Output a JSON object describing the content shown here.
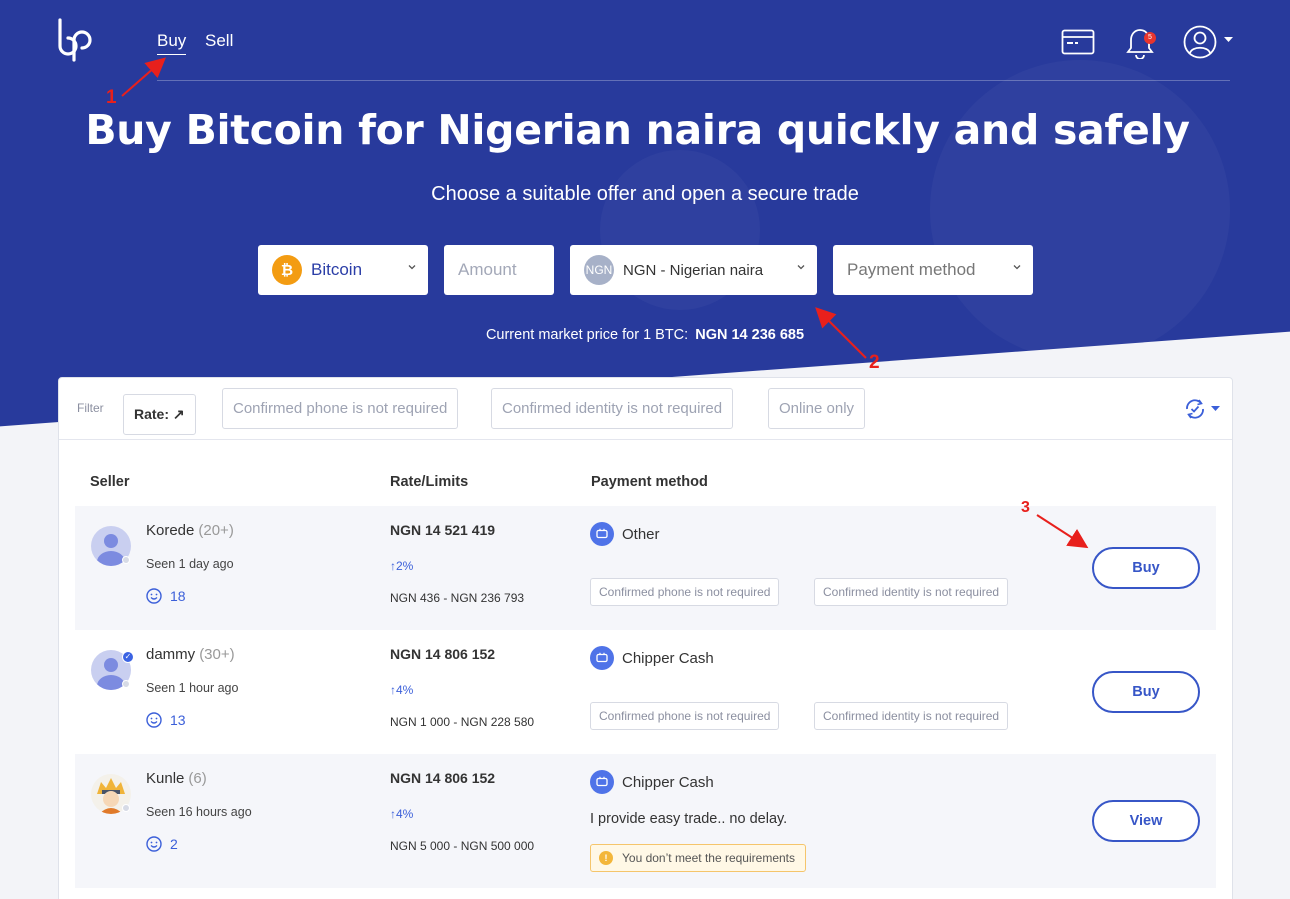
{
  "nav": {
    "buy": "Buy",
    "sell": "Sell",
    "notification_count": "5"
  },
  "hero": {
    "title": "Buy Bitcoin for Nigerian naira quickly and safely",
    "subtitle": "Choose a suitable offer and open a secure trade"
  },
  "search": {
    "crypto": "Bitcoin",
    "crypto_symbol": "₿",
    "amount_placeholder": "Amount",
    "currency": "NGN - Nigerian naira",
    "currency_code": "NGN",
    "payment_placeholder": "Payment method"
  },
  "market": {
    "label": "Current market price for 1 BTC:",
    "price": "NGN 14 236 685"
  },
  "filters": {
    "label": "Filter",
    "rate": "Rate: ↗",
    "phone": "Confirmed phone is not required",
    "identity": "Confirmed identity is not required",
    "online": "Online only"
  },
  "table": {
    "headers": {
      "seller": "Seller",
      "rate": "Rate/Limits",
      "payment": "Payment method"
    },
    "rows": [
      {
        "seller": "Korede",
        "count": "(20+)",
        "seen": "Seen 1 day ago",
        "reputation": "18",
        "rate": "NGN 14 521 419",
        "pct": "↑2%",
        "limits": "NGN 436 - NGN 236 793",
        "method": "Other",
        "tag1": "Confirmed phone is not required",
        "tag2": "Confirmed identity is not required",
        "action": "Buy"
      },
      {
        "seller": "dammy",
        "count": "(30+)",
        "seen": "Seen 1 hour ago",
        "reputation": "13",
        "rate": "NGN 14 806 152",
        "pct": "↑4%",
        "limits": "NGN 1 000 - NGN 228 580",
        "method": "Chipper Cash",
        "tag1": "Confirmed phone is not required",
        "tag2": "Confirmed identity is not required",
        "action": "Buy"
      },
      {
        "seller": "Kunle",
        "count": "(6)",
        "seen": "Seen 16 hours ago",
        "reputation": "2",
        "rate": "NGN 14 806 152",
        "pct": "↑4%",
        "limits": "NGN 5 000 - NGN 500 000",
        "method": "Chipper Cash",
        "description": "I provide easy trade.. no delay.",
        "warning": "You don’t meet the requirements",
        "action": "View"
      }
    ]
  },
  "annotations": {
    "a1": "1",
    "a2": "2",
    "a3": "3"
  },
  "colors": {
    "hero": "#283a9c",
    "accent": "#3756c7",
    "annotation": "#e8201c",
    "bitcoin": "#f39c12"
  }
}
